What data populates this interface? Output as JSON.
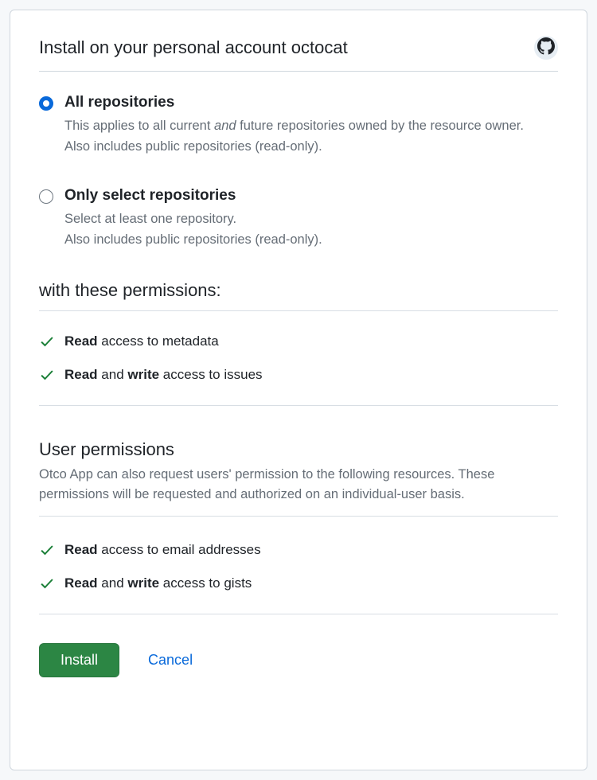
{
  "header": {
    "title": "Install on your personal account octocat"
  },
  "options": {
    "all": {
      "title": "All repositories",
      "desc_before": "This applies to all current ",
      "desc_em": "and",
      "desc_after": " future repositories owned by the resource owner.",
      "note": "Also includes public repositories (read-only)."
    },
    "select": {
      "title": "Only select repositories",
      "desc": "Select at least one repository.",
      "note": "Also includes public repositories (read-only)."
    }
  },
  "permissions": {
    "heading": "with these permissions:",
    "items": [
      {
        "strong1": "Read",
        "middle": " access to metadata",
        "strong2": "",
        "after": ""
      },
      {
        "strong1": "Read",
        "middle": " and ",
        "strong2": "write",
        "after": " access to issues"
      }
    ]
  },
  "user_permissions": {
    "heading": "User permissions",
    "desc": "Otco App can also request users' permission to the following resources. These permissions will be requested and authorized on an individual-user basis.",
    "items": [
      {
        "strong1": "Read",
        "middle": " access to email addresses",
        "strong2": "",
        "after": ""
      },
      {
        "strong1": "Read",
        "middle": " and ",
        "strong2": "write",
        "after": " access to gists"
      }
    ]
  },
  "actions": {
    "install": "Install",
    "cancel": "Cancel"
  }
}
